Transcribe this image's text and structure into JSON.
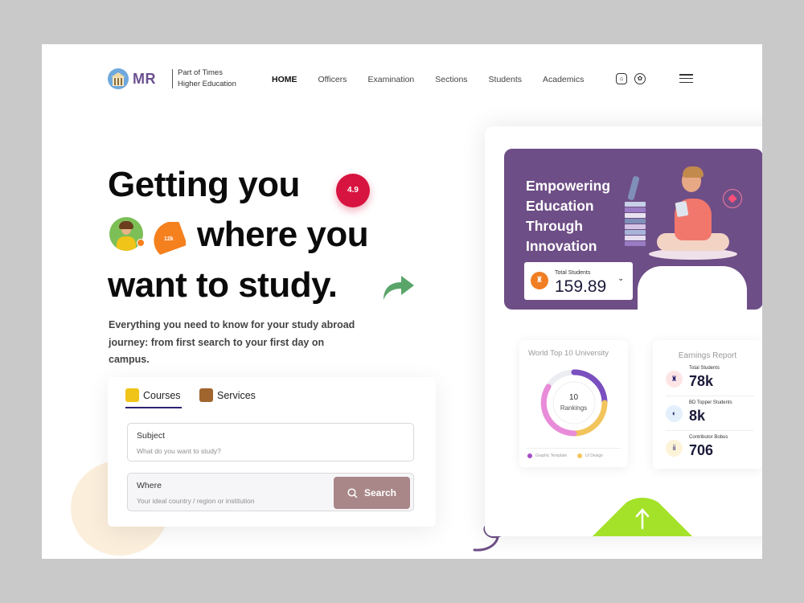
{
  "header": {
    "brand": "MR",
    "tagline_line1": "Part of Times",
    "tagline_line2": "Higher Education",
    "nav": [
      "HOME",
      "Officers",
      "Examination",
      "Sections",
      "Students",
      "Academics"
    ],
    "icons": [
      "shirt-icon",
      "globe-icon",
      "menu-icon"
    ]
  },
  "hero": {
    "line1": "Getting you",
    "line2": "where you",
    "line3": "want to study.",
    "rating": "4.9",
    "badge_count": "12k",
    "description": "Everything you need to know for your study abroad journey: from first search to your first day on campus."
  },
  "search": {
    "tabs": [
      "Courses",
      "Services"
    ],
    "subject_label": "Subject",
    "subject_placeholder": "What do you want to study?",
    "where_label": "Where",
    "where_placeholder": "Your ideal country / region or institution",
    "button": "Search"
  },
  "panel": {
    "hero_title_lines": [
      "Empowering",
      "Education",
      "Through",
      "Innovation"
    ],
    "total_students_label": "Total Students",
    "total_students_value": "159.89",
    "rank": {
      "title": "World Top 10 University",
      "value": "10",
      "label": "Rankings",
      "legend": [
        "Graphic Template",
        "UI Design"
      ]
    },
    "earnings": {
      "title": "Earnings Report",
      "rows": [
        {
          "label": "Total Students",
          "value": "78k"
        },
        {
          "label": "BD Topper Students",
          "value": "8k"
        },
        {
          "label": "Contributor Bobus",
          "value": "706"
        }
      ]
    }
  },
  "colors": {
    "accent_purple": "#6e4e86",
    "rating_red": "#d7143f",
    "search_btn": "#a98789",
    "lime": "#a4e22a"
  }
}
